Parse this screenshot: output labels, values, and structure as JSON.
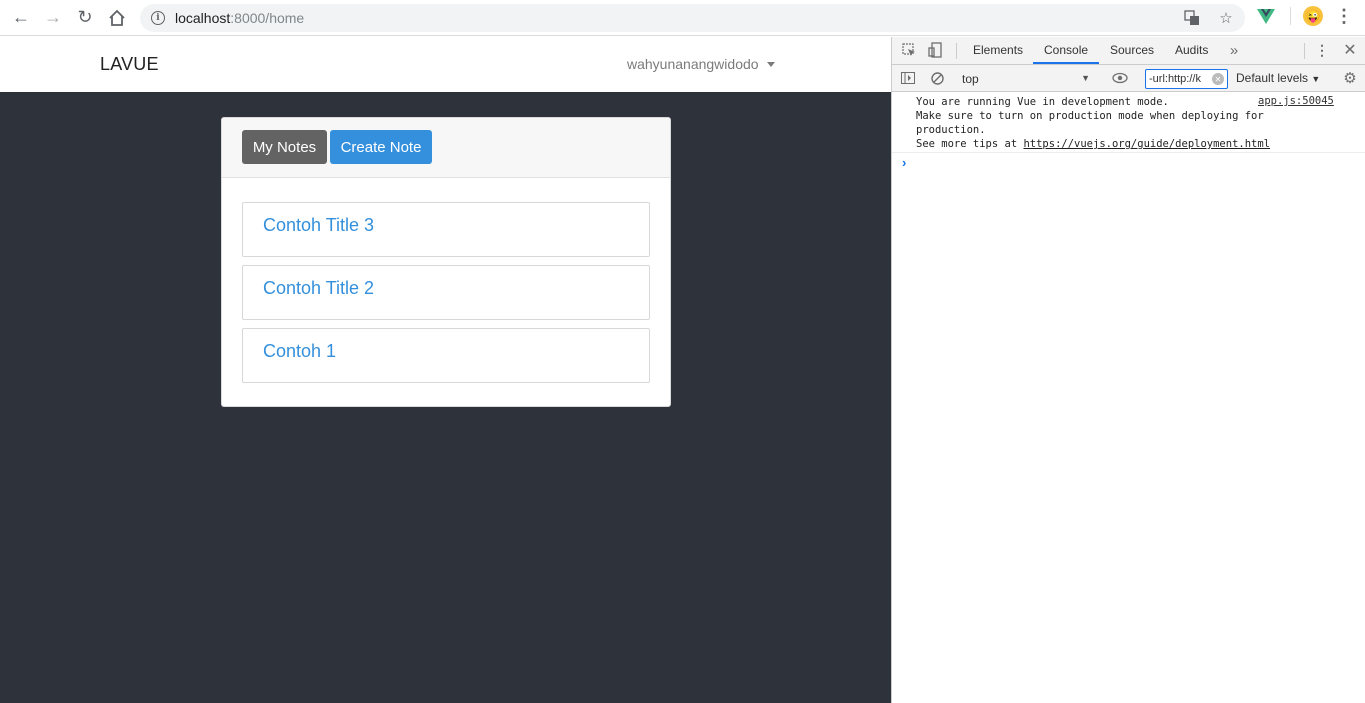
{
  "browser": {
    "url_host": "localhost",
    "url_path": ":8000/home"
  },
  "app": {
    "brand": "LAVUE",
    "username": "wahyunanangwidodo",
    "buttons": {
      "my_notes": "My Notes",
      "create_note": "Create Note"
    },
    "notes": [
      {
        "title": "Contoh Title 3"
      },
      {
        "title": "Contoh Title 2"
      },
      {
        "title": "Contoh 1"
      }
    ],
    "colors": {
      "page_bg": "#2d323b",
      "primary": "#3490dc",
      "secondary": "#636363"
    }
  },
  "devtools": {
    "tabs": [
      "Elements",
      "Console",
      "Sources",
      "Audits"
    ],
    "active_tab": "Console",
    "context": "top",
    "filter": "-url:http://k",
    "levels": "Default levels",
    "console": {
      "line1": "You are running Vue in development mode.",
      "line2": "Make sure to turn on production mode when deploying for",
      "line3": "production.",
      "line4_prefix": "See more tips at ",
      "line4_link": "https://vuejs.org/guide/deployment.html",
      "source": "app.js:50045"
    }
  }
}
